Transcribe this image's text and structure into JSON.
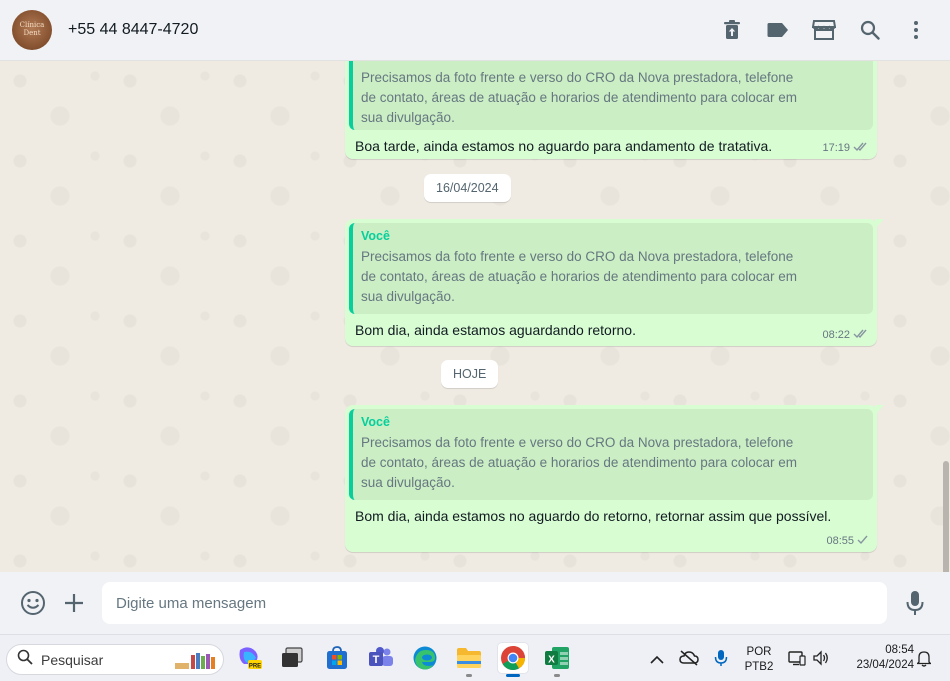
{
  "header": {
    "contact_name": "+55 44 8447-4720",
    "avatar_text": "Clínica Dent",
    "icons": [
      "delete-icon",
      "label-icon",
      "catalog-icon",
      "search-icon",
      "menu-icon"
    ]
  },
  "messages": [
    {
      "quote_text": "Precisamos da foto frente e verso do CRO da Nova prestadora, telefone de contato, áreas de atuação e horarios de atendimento para colocar em sua divulgação.",
      "text": "Boa tarde, ainda estamos no aguardo para andamento de tratativa.",
      "time": "17:19",
      "status": "read"
    },
    {
      "quote_author": "Você",
      "quote_text": "Precisamos da foto frente e verso do CRO da Nova prestadora, telefone de contato, áreas de atuação e horarios de atendimento para colocar em sua divulgação.",
      "text": "Bom dia, ainda estamos aguardando retorno.",
      "time": "08:22",
      "status": "read"
    },
    {
      "quote_author": "Você",
      "quote_text": "Precisamos da foto frente e verso do CRO da Nova prestadora, telefone de contato, áreas de atuação e horarios de atendimento para colocar em sua divulgação.",
      "text": "Bom dia, ainda estamos no aguardo do retorno, retornar assim que possível.",
      "time": "08:55",
      "status": "sent"
    }
  ],
  "date_separators": [
    "16/04/2024",
    "HOJE"
  ],
  "composer": {
    "placeholder": "Digite uma mensagem"
  },
  "taskbar": {
    "search_label": "Pesquisar",
    "language_line1": "POR",
    "language_line2": "PTB2",
    "clock_time": "08:54",
    "clock_date": "23/04/2024",
    "apps": [
      "copilot-icon",
      "task-view-icon",
      "store-icon",
      "teams-icon",
      "edge-icon",
      "file-explorer-icon",
      "chrome-icon",
      "excel-icon"
    ]
  },
  "colors": {
    "outgoing_bubble": "#d9fdd3",
    "quote_accent": "#06cf9c",
    "header_bg": "#f0f2f5",
    "chat_bg": "#efeae2",
    "read_tick": "#53bdeb"
  }
}
